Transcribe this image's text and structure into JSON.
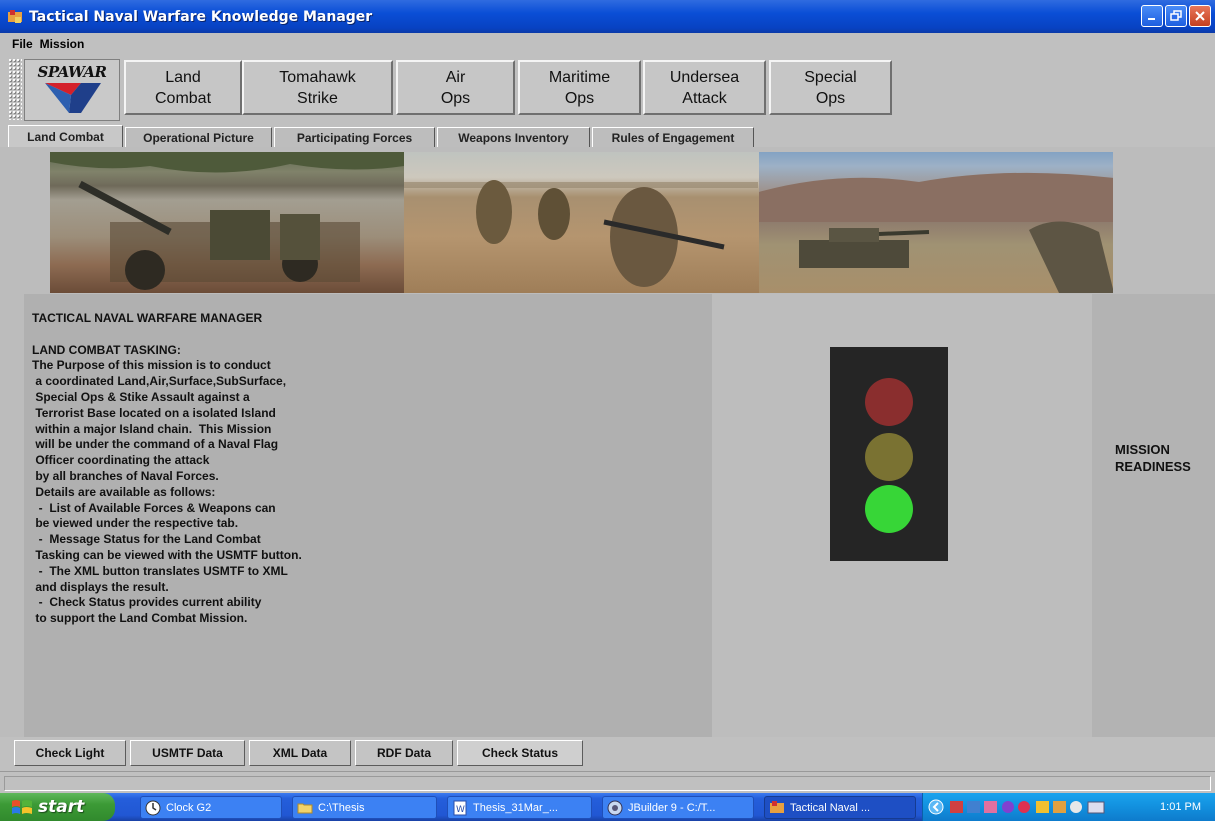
{
  "window": {
    "title": "Tactical Naval Warfare Knowledge Manager"
  },
  "menu": [
    "File",
    "Mission"
  ],
  "toolbar": {
    "logo_text": "SPAWAR",
    "buttons": [
      {
        "line1": "Land",
        "line2": "Combat"
      },
      {
        "line1": "Tomahawk",
        "line2": "Strike"
      },
      {
        "line1": "Air",
        "line2": "Ops"
      },
      {
        "line1": "Maritime",
        "line2": "Ops"
      },
      {
        "line1": "Undersea",
        "line2": "Attack"
      },
      {
        "line1": "Special",
        "line2": "Ops"
      }
    ]
  },
  "tabs": [
    "Land Combat",
    "Operational Picture",
    "Participating Forces",
    "Weapons Inventory",
    "Rules of Engagement"
  ],
  "active_tab": "Land Combat",
  "content": {
    "text": "TACTICAL NAVAL WARFARE MANAGER\n\nLAND COMBAT TASKING:\nThe Purpose of this mission is to conduct\n a coordinated Land,Air,Surface,SubSurface,\n Special Ops & Stike Assault against a\n Terrorist Base located on a isolated Island\n within a major Island chain.  This Mission\n will be under the command of a Naval Flag\n Officer coordinating the attack\n by all branches of Naval Forces.\n Details are available as follows:\n  -  List of Available Forces & Weapons can\n be viewed under the respective tab.\n  -  Message Status for the Land Combat\n Tasking can be viewed with the USMTF button.\n  -  The XML button translates USMTF to XML\n and displays the result.\n  -  Check Status provides current ability\n to support the Land Combat Mission.",
    "readiness_line1": "MISSION",
    "readiness_line2": "READINESS",
    "traffic_light": {
      "red": "#8a2e2e",
      "yellow": "#7a7232",
      "green": "#37d637",
      "active": "green"
    }
  },
  "bottom_buttons": [
    "Check Light",
    "USMTF Data",
    "XML Data",
    "RDF Data",
    "Check Status"
  ],
  "taskbar": {
    "start_label": "start",
    "tasks": [
      "Clock G2",
      "C:\\Thesis",
      "Thesis_31Mar_...",
      "JBuilder 9 - C:/T...",
      "Tactical Naval ..."
    ],
    "clock": "1:01 PM"
  }
}
